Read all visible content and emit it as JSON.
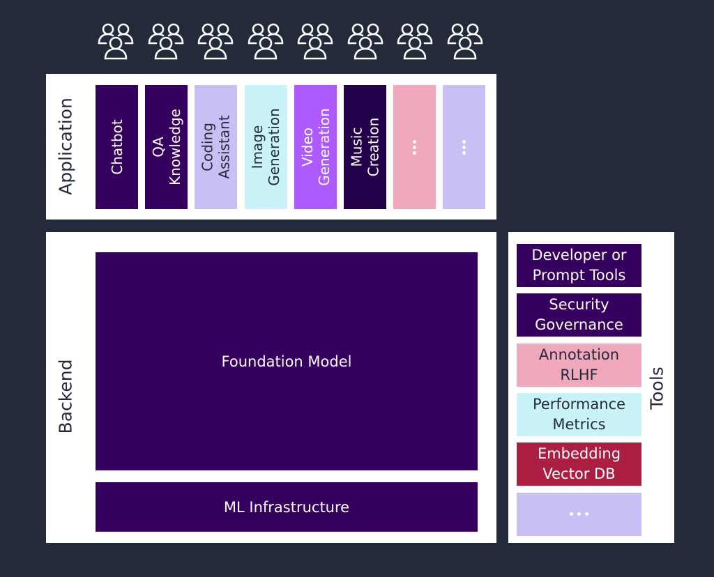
{
  "users": {
    "count": 8,
    "icon": "user-group-icon"
  },
  "application": {
    "label": "Application",
    "items": [
      {
        "label": "Chatbot",
        "color": "#36005f",
        "style": "dark"
      },
      {
        "label": "QA\nKnowledge",
        "color": "#36005f",
        "style": "dark"
      },
      {
        "label": "Coding\nAssistant",
        "color": "#c9bff5",
        "style": "lilac"
      },
      {
        "label": "Image\nGeneration",
        "color": "#c9f3f8",
        "style": "cyan"
      },
      {
        "label": "Video\nGeneration",
        "color": "#ad5aff",
        "style": "violet"
      },
      {
        "label": "Music\nCreation",
        "color": "#23004a",
        "style": "darker"
      },
      {
        "label": "…",
        "color": "#f0a8bc",
        "style": "pink",
        "placeholder": true
      },
      {
        "label": "…",
        "color": "#c9bff5",
        "style": "lilac",
        "placeholder": true
      }
    ]
  },
  "backend": {
    "label": "Backend",
    "foundation_model": "Foundation Model",
    "ml_infrastructure": "ML Infrastructure"
  },
  "tools": {
    "label": "Tools",
    "items": [
      {
        "label": "Developer or\nPrompt Tools",
        "style": "dark"
      },
      {
        "label": "Security\nGovernance",
        "style": "dark"
      },
      {
        "label": "Annotation\nRLHF",
        "style": "pink"
      },
      {
        "label": "Performance\nMetrics",
        "style": "cyan"
      },
      {
        "label": "Embedding\nVector DB",
        "style": "crimson"
      },
      {
        "label": "…",
        "style": "lilac",
        "placeholder": true
      }
    ]
  },
  "colors": {
    "background": "#232b3a",
    "panel": "#ffffff",
    "dark_purple": "#36005f",
    "darker_purple": "#23004a",
    "lilac": "#c9bff5",
    "cyan": "#c9f3f8",
    "violet": "#ad5aff",
    "pink": "#f0a8bc",
    "crimson": "#ab1d41"
  }
}
